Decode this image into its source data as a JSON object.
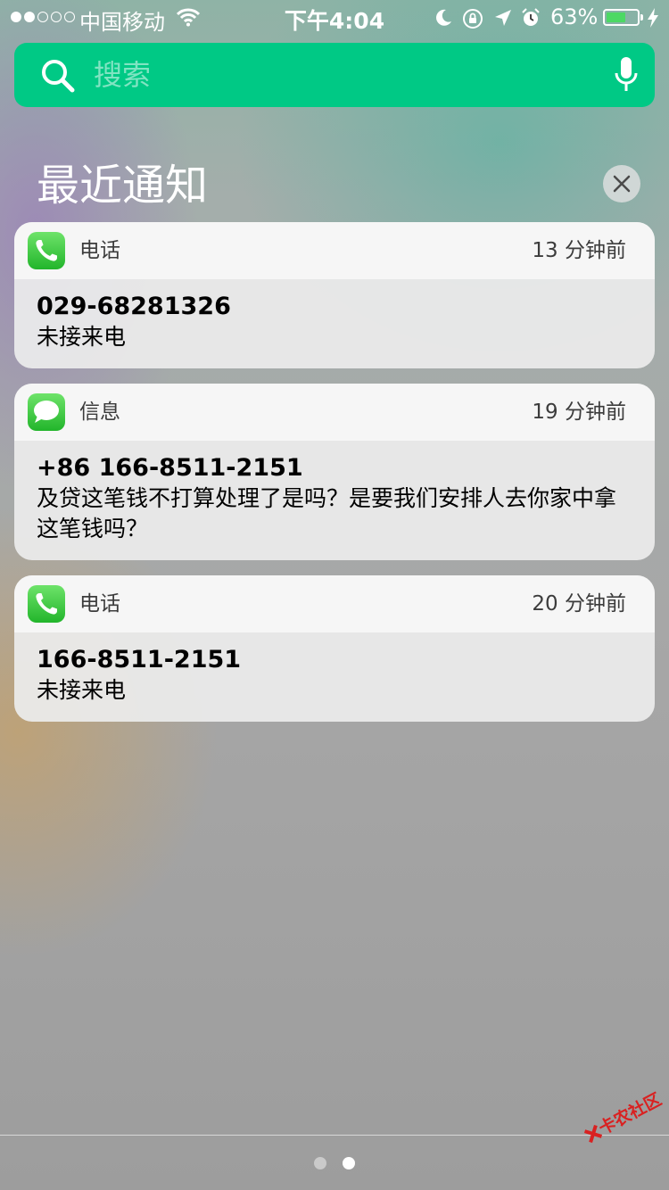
{
  "status_bar": {
    "carrier": "中国移动",
    "time": "下午4:04",
    "battery": "63%",
    "battery_level": 0.63,
    "signal_bars_filled": 2,
    "signal_bars_total": 5
  },
  "search": {
    "placeholder": "搜索"
  },
  "section": {
    "title": "最近通知"
  },
  "notifications": [
    {
      "app": "电话",
      "icon": "phone-icon",
      "time": "13 分钟前",
      "title": "029-68281326",
      "message": "未接来电"
    },
    {
      "app": "信息",
      "icon": "messages-icon",
      "time": "19 分钟前",
      "title": "+86 166-8511-2151",
      "message": "及贷这笔钱不打算处理了是吗？是要我们安排人去你家中拿这笔钱吗？"
    },
    {
      "app": "电话",
      "icon": "phone-icon",
      "time": "20 分钟前",
      "title": "166-8511-2151",
      "message": "未接来电"
    }
  ],
  "page_indicator": {
    "count": 2,
    "current": 2
  },
  "watermark": {
    "text": "卡农社区"
  },
  "colors": {
    "search_bg": "#00c985",
    "phone_green": "#34c759",
    "battery_green": "#4cd964"
  }
}
